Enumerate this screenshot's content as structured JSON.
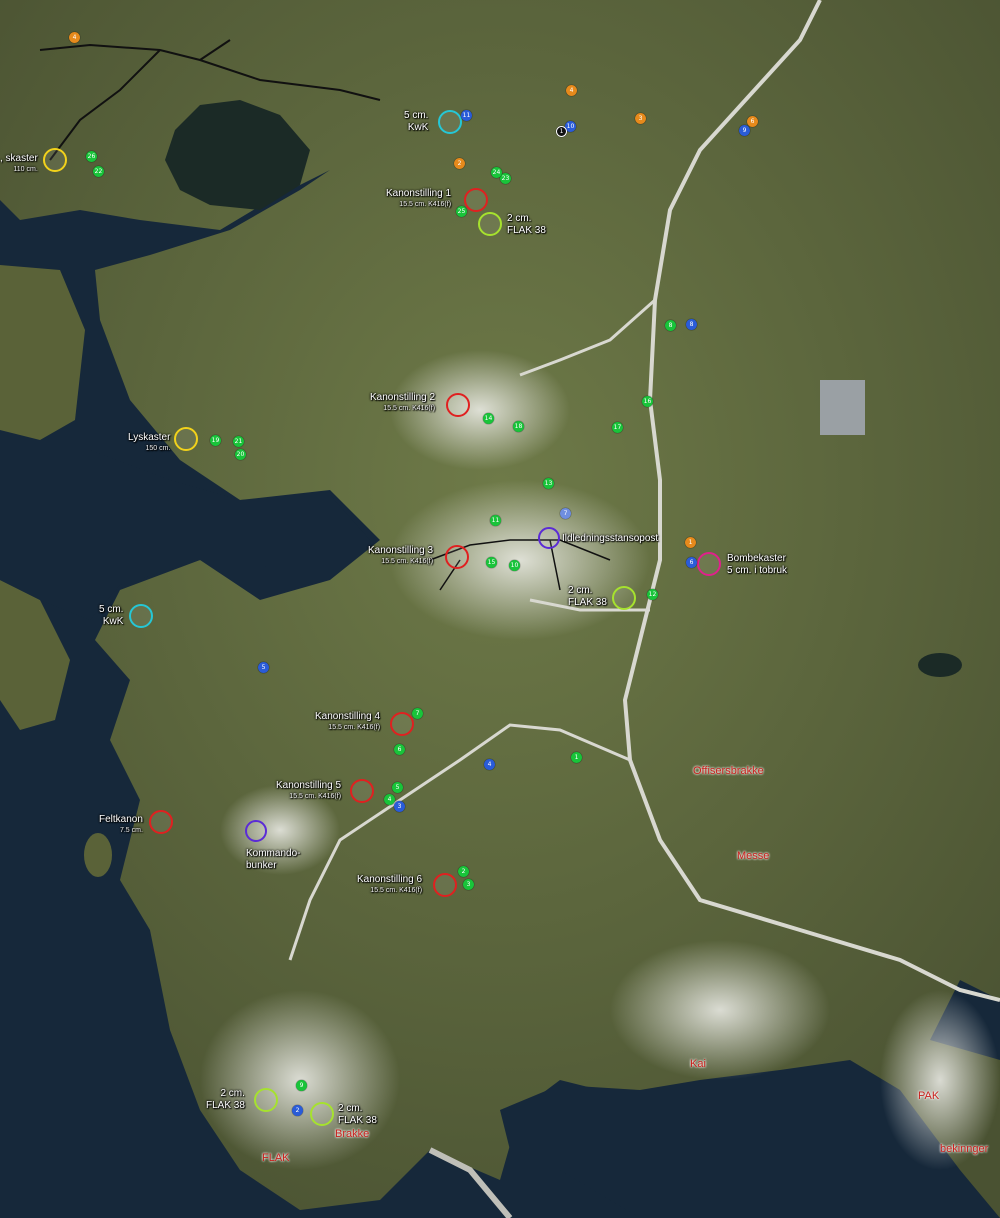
{
  "map": {
    "colors": {
      "gun": "#e02020",
      "flak": "#a6e22e",
      "kwk": "#25c7d6",
      "searchlight": "#f2d21b",
      "mortar": "#e0208c",
      "bunker": "#5b2bd6",
      "marker_green": "#19c43a",
      "marker_blue": "#2a5cd8",
      "marker_orange": "#e68a1c",
      "building_label": "#c8201c",
      "water": "#16283a",
      "land": "#5e6b3e"
    },
    "labels": {
      "lyskaster_top": {
        "title": ", skaster",
        "sub": "110 cm."
      },
      "kwk_top": {
        "title": "5 cm.",
        "line2": "KwK"
      },
      "kanon1": {
        "title": "Kanonstilling 1",
        "sub": "15.5 cm. K416(f)"
      },
      "flak_top": {
        "title": "2 cm.",
        "line2": "FLAK 38"
      },
      "kanon2": {
        "title": "Kanonstilling 2",
        "sub": "15.5 cm. K416(f)"
      },
      "lyskaster_mid": {
        "title": "Lyskaster",
        "sub": "150 cm."
      },
      "kanon3": {
        "title": "Kanonstilling 3",
        "sub": "15.5 cm. K416(f)"
      },
      "ildledning": {
        "title": "Ildledningsstansopost"
      },
      "flak_mid": {
        "title": "2 cm.",
        "line2": "FLAK 38"
      },
      "bombekaster": {
        "title": "Bombekaster",
        "line2": "5 cm. i tobruk"
      },
      "kwk_mid": {
        "title": "5 cm.",
        "line2": "KwK"
      },
      "kanon4": {
        "title": "Kanonstilling 4",
        "sub": "15.5 cm. K416(f)"
      },
      "kanon5": {
        "title": "Kanonstilling 5",
        "sub": "15.5 cm. K416(f)"
      },
      "feltkanon": {
        "title": "Feltkanon",
        "sub": "7.5 cm."
      },
      "kommando": {
        "title": "Kommando-",
        "line2": "bunker"
      },
      "kanon6": {
        "title": "Kanonstilling 6",
        "sub": "15.5 cm. K416(f)"
      },
      "flak_bl": {
        "title": "2 cm.",
        "line2": "FLAK 38"
      },
      "flak_bl2": {
        "title": "2 cm.",
        "line2": "FLAK 38"
      },
      "offisersbrakke": "Offisersbrakke",
      "messe": "Messe",
      "kai": "Kai",
      "pak": "PAK",
      "brakke": "Brakke",
      "flak_red": "FLAK",
      "bekinnger": "bekinnger"
    },
    "markers": {
      "green": [
        "12",
        "13",
        "18",
        "19",
        "20",
        "21",
        "22",
        "23",
        "24",
        "25",
        "26",
        "11",
        "10",
        "14",
        "15",
        "16",
        "17",
        "1",
        "2",
        "3",
        "4",
        "5",
        "6",
        "7",
        "8",
        "9"
      ],
      "blue": [
        "11",
        "10",
        "9",
        "8",
        "6",
        "5",
        "4",
        "3",
        "2"
      ],
      "orange": [
        "4",
        "2",
        "3",
        "6",
        "1",
        "4"
      ],
      "lightblue": [
        "7"
      ],
      "white": [
        "1"
      ]
    }
  }
}
